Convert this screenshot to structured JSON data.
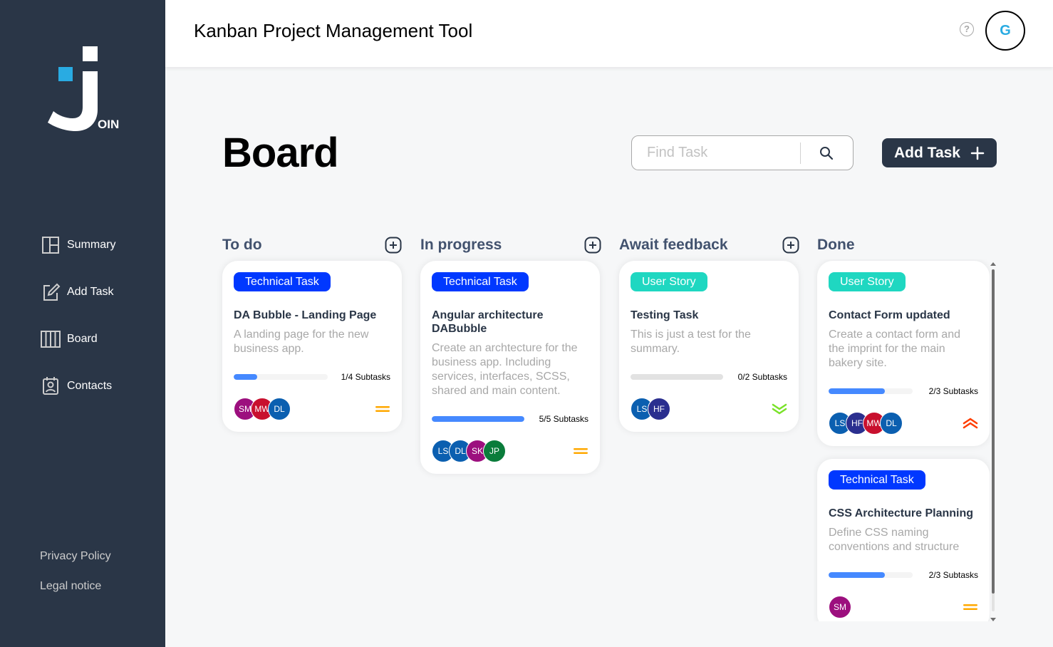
{
  "app": {
    "title": "Kanban Project Management Tool",
    "logo_text": "OIN"
  },
  "header": {
    "help_icon": "?",
    "user_initial": "G"
  },
  "sidebar": {
    "items": [
      {
        "label": "Summary",
        "icon": "summary-icon"
      },
      {
        "label": "Add Task",
        "icon": "add-task-icon"
      },
      {
        "label": "Board",
        "icon": "board-icon"
      },
      {
        "label": "Contacts",
        "icon": "contacts-icon"
      }
    ],
    "legal": [
      "Privacy Policy",
      "Legal notice"
    ]
  },
  "board": {
    "title": "Board",
    "search_placeholder": "Find Task",
    "add_task_label": "Add Task"
  },
  "columns": [
    {
      "title": "To do"
    },
    {
      "title": "In progress"
    },
    {
      "title": "Await feedback"
    },
    {
      "title": "Done"
    }
  ],
  "cards": [
    {
      "tag": "Technical Task",
      "tag_type": "tech",
      "title": "DA Bubble - Landing Page",
      "description": "A landing page for the new business app.",
      "subtasks": "1/4 Subtasks",
      "progress": 0.25,
      "assignees": [
        {
          "initials": "SM",
          "color": "#9c0f7e"
        },
        {
          "initials": "MW",
          "color": "#c8102e"
        },
        {
          "initials": "DL",
          "color": "#0b5fb0"
        }
      ],
      "priority": "medium"
    },
    {
      "tag": "Technical Task",
      "tag_type": "tech",
      "title": "Angular architecture DABubble",
      "description": "Create an archtecture for the business app. Including services, interfaces, SCSS, shared and main content.",
      "subtasks": "5/5 Subtasks",
      "progress": 1.0,
      "assignees": [
        {
          "initials": "LS",
          "color": "#0b5fb0"
        },
        {
          "initials": "DL",
          "color": "#0b5fb0"
        },
        {
          "initials": "SK",
          "color": "#9c0f7e"
        },
        {
          "initials": "JP",
          "color": "#0a7c3b"
        }
      ],
      "priority": "medium"
    },
    {
      "tag": "User Story",
      "tag_type": "story",
      "title": "Testing Task",
      "description": "This is just a test for the summary.",
      "subtasks": "0/2 Subtasks",
      "progress": 0,
      "assignees": [
        {
          "initials": "LS",
          "color": "#0b5fb0"
        },
        {
          "initials": "HF",
          "color": "#2b2f8f"
        }
      ],
      "priority": "low"
    },
    {
      "tag": "User Story",
      "tag_type": "story",
      "title": "Contact Form updated",
      "description": "Create a contact form and the imprint for the main bakery site.",
      "subtasks": "2/3 Subtasks",
      "progress": 0.667,
      "assignees": [
        {
          "initials": "LS",
          "color": "#0b5fb0"
        },
        {
          "initials": "HF",
          "color": "#2b2f8f"
        },
        {
          "initials": "MW",
          "color": "#c8102e"
        },
        {
          "initials": "DL",
          "color": "#0b5fb0"
        }
      ],
      "priority": "urgent"
    },
    {
      "tag": "Technical Task",
      "tag_type": "tech",
      "title": "CSS Architecture Planning",
      "description": "Define CSS naming conventions and structure",
      "subtasks": "2/3 Subtasks",
      "progress": 0.667,
      "assignees": [
        {
          "initials": "SM",
          "color": "#9c0f7e"
        }
      ],
      "priority": "medium"
    }
  ],
  "colors": {
    "sidebar": "#2a3647",
    "tech_tag": "#0038ff",
    "story_tag": "#1fd7c1",
    "progress": "#4589ff",
    "medium": "#ffa800",
    "low": "#7ae229",
    "urgent": "#ff3d00"
  }
}
